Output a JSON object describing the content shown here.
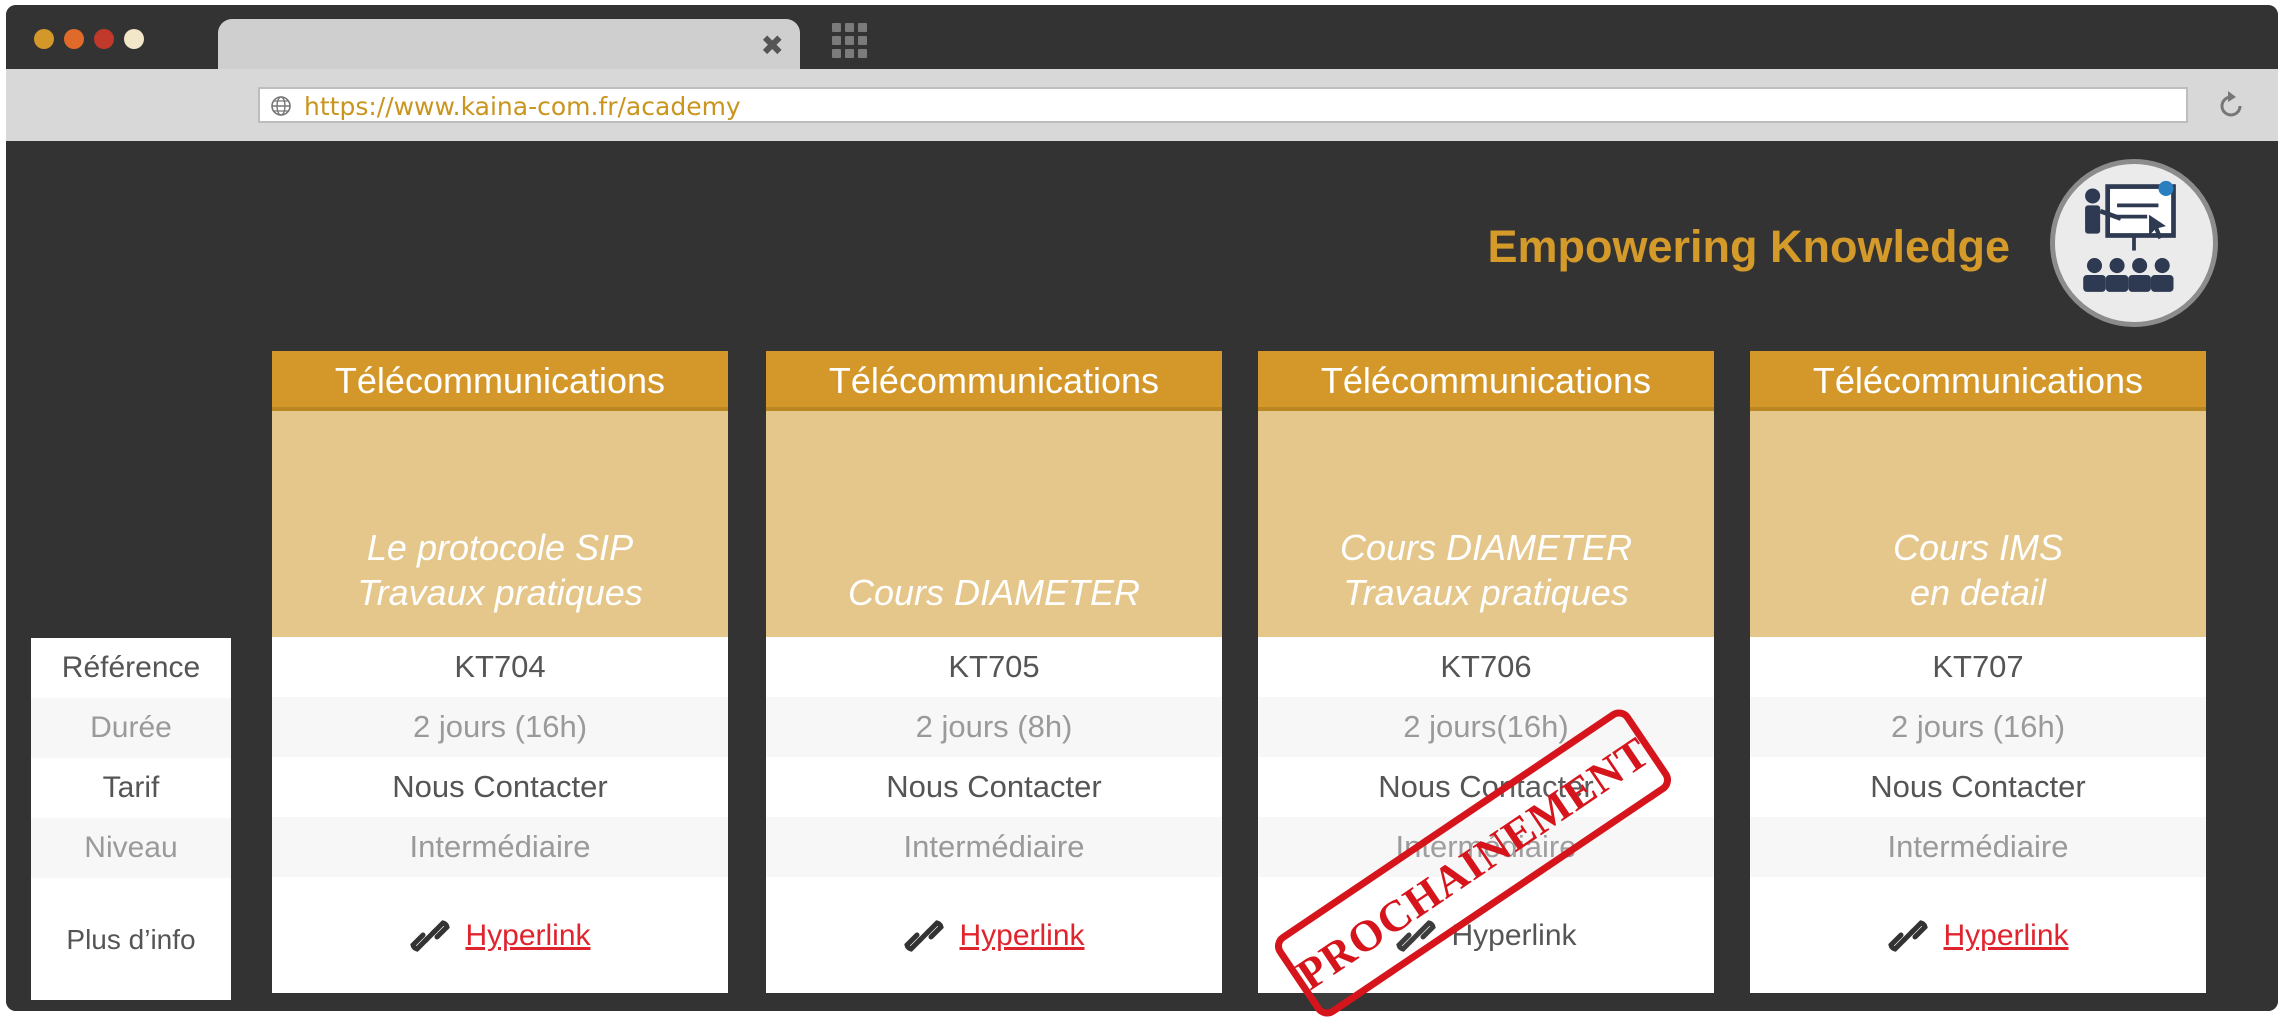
{
  "browser": {
    "url": "https://www.kaina-com.fr/academy",
    "traffic_lights": [
      "#d4982a",
      "#e06a2a",
      "#c0392b",
      "#f3e7c9"
    ]
  },
  "page": {
    "headline": "Empowering Knowledge",
    "labels": [
      "Référence",
      "Durée",
      "Tarif",
      "Niveau",
      "Plus d’info"
    ],
    "cards": [
      {
        "category": "Télécommunications",
        "title_line1": "Le protocole SIP",
        "title_line2": "Travaux pratiques",
        "reference": "KT704",
        "duration": "2 jours (16h)",
        "price": "Nous Contacter",
        "level": "Intermédiaire",
        "link_text": "Hyperlink"
      },
      {
        "category": "Télécommunications",
        "title_line1": "",
        "title_line2": "Cours DIAMETER",
        "reference": "KT705",
        "duration": "2 jours (8h)",
        "price": "Nous Contacter",
        "level": "Intermédiaire",
        "link_text": "Hyperlink"
      },
      {
        "category": "Télécommunications",
        "title_line1": "Cours DIAMETER",
        "title_line2": "Travaux pratiques",
        "reference": "KT706",
        "duration": "2 jours(16h)",
        "price": "Nous Contacter",
        "level": "Intermédiaire",
        "link_text": "Hyperlink"
      },
      {
        "category": "Télécommunications",
        "title_line1": "Cours IMS",
        "title_line2": "en detail",
        "reference": "KT707",
        "duration": "2 jours (16h)",
        "price": "Nous Contacter",
        "level": "Intermédiaire",
        "link_text": "Hyperlink"
      }
    ],
    "stamp": "PROCHAINEMENT"
  },
  "colors": {
    "accent": "#d4982a",
    "title_band": "#e5c78c",
    "link": "#e0242e",
    "stamp": "#d6141c"
  },
  "icons": [
    "globe-icon",
    "reload-icon",
    "apps-grid-icon",
    "close-icon",
    "presentation-icon",
    "link-icon"
  ]
}
